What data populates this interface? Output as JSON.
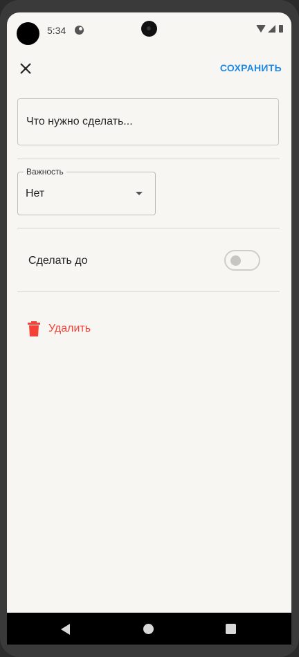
{
  "status_bar": {
    "time": "5:34",
    "icons": [
      "avatar",
      "app-notification-icon",
      "camera",
      "wifi-icon",
      "signal-icon",
      "battery-icon"
    ]
  },
  "app_bar": {
    "close_icon": "close-icon",
    "save_label": "СОХРАНИТЬ"
  },
  "task": {
    "placeholder": "Что нужно сделать...",
    "value": ""
  },
  "importance": {
    "label": "Важность",
    "selected": "Нет"
  },
  "deadline": {
    "label": "Сделать до",
    "enabled": false
  },
  "delete": {
    "label": "Удалить",
    "icon": "trash-icon"
  },
  "colors": {
    "accent": "#1e88e5",
    "danger": "#f44336",
    "background": "#f7f6f3"
  },
  "nav_bar": {
    "icons": [
      "back-icon",
      "home-icon",
      "recents-icon"
    ]
  }
}
